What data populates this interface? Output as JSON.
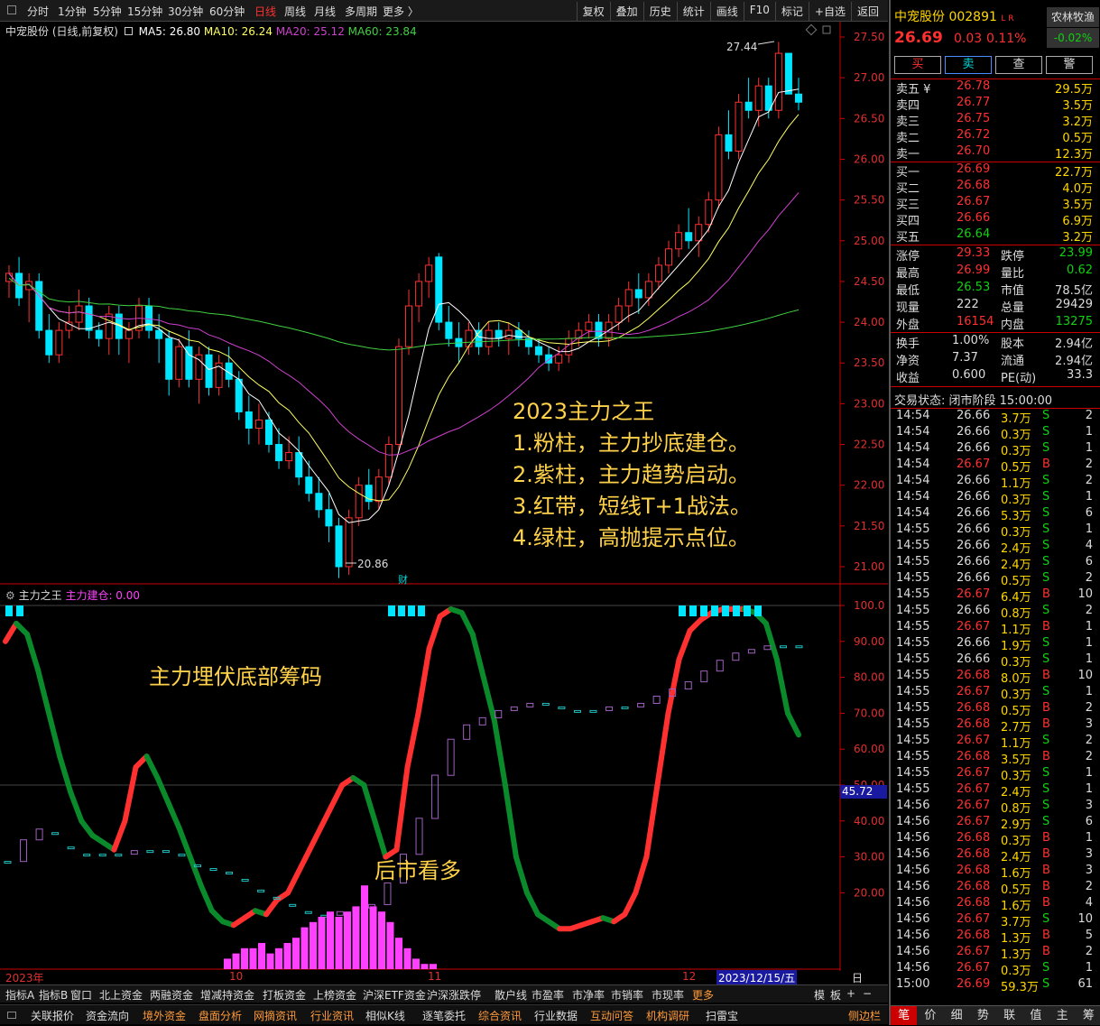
{
  "toolbar": {
    "periods": [
      "分时",
      "1分钟",
      "5分钟",
      "15分钟",
      "30分钟",
      "60分钟",
      "日线",
      "周线",
      "月线",
      "多周期",
      "更多 〉"
    ],
    "active": "日线",
    "right": [
      "复权",
      "叠加",
      "历史",
      "统计",
      "画线",
      "F10",
      "标记",
      "+自选",
      "返回"
    ]
  },
  "legend": {
    "title": "中宠股份 (日线,前复权)",
    "ma5": "MA5: 26.80",
    "ma10": "MA10: 26.24",
    "ma20": "MA20: 25.12",
    "ma60": "MA60: 23.84"
  },
  "colors": {
    "up": "#ff3030",
    "down": "#00e5ff",
    "ma5": "#ffffff",
    "ma10": "#ffff60",
    "ma20": "#d040d0",
    "ma60": "#40d040",
    "annot": "#ffd24a",
    "pink": "#ff40ff",
    "purple": "#a060c0"
  },
  "price_axis": [
    "27.50",
    "27.00",
    "26.50",
    "26.00",
    "25.50",
    "25.00",
    "24.50",
    "24.00",
    "23.50",
    "23.00",
    "22.50",
    "22.00",
    "21.50",
    "21.00"
  ],
  "ind_axis": [
    "100.0",
    "90.00",
    "80.00",
    "70.00",
    "60.00",
    "50.00",
    "40.00",
    "30.00",
    "20.00"
  ],
  "markers": {
    "high": "27.44",
    "low": "20.86",
    "fin": "财",
    "cur": "45.72"
  },
  "ind_legend": {
    "name": "主力之王",
    "label": "主力建仓: 0.00"
  },
  "annotations": {
    "title": "2023主力之王",
    "l1": "1.粉柱，主力抄底建仓。",
    "l2": "2.紫柱，主力趋势启动。",
    "l3": "3.红带，短线T+1战法。",
    "l4": "4.绿柱，高抛提示点位。",
    "bottom_chips": "主力埋伏底部筹码",
    "bullish": "后市看多"
  },
  "dates": {
    "y2023": "2023年",
    "m10": "10",
    "m11": "11",
    "m12": "12",
    "cursor": "2023/12/15/五",
    "period": "日线"
  },
  "bottombar1": [
    "指标A",
    "指标B",
    "窗口",
    "北上资金",
    "两融资金",
    "增减持资金",
    "打板资金",
    "上榜资金",
    "沪深ETF资金",
    "沪深涨跌停",
    "散户线",
    "市盈率",
    "市净率",
    "市销率",
    "市现率",
    "更多"
  ],
  "bottombar1_right": [
    "模",
    "板",
    "+",
    "−"
  ],
  "bottombar2": [
    "关联报价",
    "资金流向",
    "境外资金",
    "盘面分析",
    "网摘资讯",
    "行业资讯",
    "相似K线",
    "逐笔委托",
    "综合资讯",
    "行业数据",
    "互动问答",
    "机构调研",
    "扫雷宝"
  ],
  "bottombar2_right": "侧边栏",
  "quote": {
    "name": "中宠股份",
    "code": "002891",
    "tag": "L R",
    "price": "26.69",
    "chg": "0.03",
    "pct": "0.11%",
    "sector": "农林牧渔",
    "sector_pct": "-0.02%",
    "buttons": [
      "买",
      "卖",
      "查",
      "警"
    ],
    "sell": [
      [
        "卖五 ¥",
        "26.78",
        "29.5万"
      ],
      [
        "卖四",
        "26.77",
        "3.5万"
      ],
      [
        "卖三",
        "26.75",
        "3.2万"
      ],
      [
        "卖二",
        "26.72",
        "0.5万"
      ],
      [
        "卖一",
        "26.70",
        "12.3万"
      ]
    ],
    "buy": [
      [
        "买一",
        "26.69",
        "22.7万"
      ],
      [
        "买二",
        "26.68",
        "4.0万"
      ],
      [
        "买三",
        "26.67",
        "3.5万"
      ],
      [
        "买四",
        "26.66",
        "6.9万"
      ],
      [
        "买五",
        "26.64",
        "3.2万"
      ]
    ],
    "stats": [
      [
        "涨停",
        "29.33",
        "跌停",
        "23.99"
      ],
      [
        "最高",
        "26.99",
        "量比",
        "0.62"
      ],
      [
        "最低",
        "26.53",
        "市值",
        "78.5亿"
      ],
      [
        "现量",
        "222",
        "总量",
        "29429"
      ],
      [
        "外盘",
        "16154",
        "内盘",
        "13275"
      ]
    ],
    "stats2": [
      [
        "换手",
        "1.00%",
        "股本",
        "2.94亿"
      ],
      [
        "净资",
        "7.37",
        "流通",
        "2.94亿"
      ],
      [
        "收益",
        "0.600",
        "PE(动)",
        "33.3"
      ]
    ],
    "status": "交易状态: 闭市阶段 15:00:00",
    "ticks": [
      [
        "14:54",
        "26.66",
        "3.7万",
        "S",
        "2"
      ],
      [
        "14:54",
        "26.66",
        "0.3万",
        "S",
        "1"
      ],
      [
        "14:54",
        "26.66",
        "0.3万",
        "S",
        "1"
      ],
      [
        "14:54",
        "26.67",
        "0.5万",
        "B",
        "2"
      ],
      [
        "14:54",
        "26.66",
        "1.1万",
        "S",
        "2"
      ],
      [
        "14:54",
        "26.66",
        "0.3万",
        "S",
        "1"
      ],
      [
        "14:54",
        "26.66",
        "5.3万",
        "S",
        "6"
      ],
      [
        "14:55",
        "26.66",
        "0.3万",
        "S",
        "1"
      ],
      [
        "14:55",
        "26.66",
        "2.4万",
        "S",
        "4"
      ],
      [
        "14:55",
        "26.66",
        "2.4万",
        "S",
        "6"
      ],
      [
        "14:55",
        "26.66",
        "0.5万",
        "S",
        "2"
      ],
      [
        "14:55",
        "26.67",
        "6.4万",
        "B",
        "10"
      ],
      [
        "14:55",
        "26.66",
        "0.8万",
        "S",
        "2"
      ],
      [
        "14:55",
        "26.67",
        "1.1万",
        "B",
        "1"
      ],
      [
        "14:55",
        "26.66",
        "1.9万",
        "S",
        "1"
      ],
      [
        "14:55",
        "26.66",
        "0.3万",
        "S",
        "1"
      ],
      [
        "14:55",
        "26.68",
        "8.0万",
        "B",
        "10"
      ],
      [
        "14:55",
        "26.67",
        "0.3万",
        "S",
        "1"
      ],
      [
        "14:55",
        "26.68",
        "0.5万",
        "B",
        "2"
      ],
      [
        "14:55",
        "26.68",
        "2.7万",
        "B",
        "3"
      ],
      [
        "14:55",
        "26.67",
        "1.1万",
        "S",
        "2"
      ],
      [
        "14:55",
        "26.68",
        "3.5万",
        "B",
        "2"
      ],
      [
        "14:55",
        "26.67",
        "0.3万",
        "S",
        "1"
      ],
      [
        "14:55",
        "26.67",
        "2.4万",
        "S",
        "1"
      ],
      [
        "14:56",
        "26.67",
        "0.8万",
        "S",
        "3"
      ],
      [
        "14:56",
        "26.67",
        "2.9万",
        "S",
        "6"
      ],
      [
        "14:56",
        "26.68",
        "0.3万",
        "B",
        "1"
      ],
      [
        "14:56",
        "26.68",
        "2.4万",
        "B",
        "3"
      ],
      [
        "14:56",
        "26.68",
        "1.6万",
        "B",
        "3"
      ],
      [
        "14:56",
        "26.68",
        "0.5万",
        "B",
        "2"
      ],
      [
        "14:56",
        "26.68",
        "1.6万",
        "B",
        "4"
      ],
      [
        "14:56",
        "26.67",
        "3.7万",
        "S",
        "10"
      ],
      [
        "14:56",
        "26.68",
        "1.3万",
        "B",
        "5"
      ],
      [
        "14:56",
        "26.67",
        "1.3万",
        "B",
        "2"
      ],
      [
        "14:56",
        "26.67",
        "0.3万",
        "S",
        "1"
      ],
      [
        "15:00",
        "26.69",
        "59.3万",
        "S",
        "61"
      ]
    ],
    "tabs": [
      "笔",
      "价",
      "细",
      "势",
      "联",
      "值",
      "主",
      "筹"
    ]
  },
  "chart_data": {
    "type": "candlestick",
    "title": "中宠股份 (日线,前复权)",
    "ylim": [
      20.6,
      27.75
    ],
    "candles": [
      [
        24.5,
        24.7,
        24.3,
        24.6
      ],
      [
        24.6,
        24.8,
        24.2,
        24.3
      ],
      [
        24.4,
        24.6,
        24.0,
        24.5
      ],
      [
        24.5,
        24.6,
        23.8,
        23.9
      ],
      [
        23.9,
        24.1,
        23.5,
        23.6
      ],
      [
        23.6,
        24.0,
        23.5,
        23.9
      ],
      [
        23.9,
        24.2,
        23.8,
        24.0
      ],
      [
        24.0,
        24.4,
        23.9,
        24.2
      ],
      [
        24.2,
        24.3,
        23.8,
        23.9
      ],
      [
        23.9,
        24.0,
        23.7,
        23.8
      ],
      [
        23.8,
        24.2,
        23.6,
        24.1
      ],
      [
        24.1,
        24.2,
        23.6,
        23.8
      ],
      [
        23.8,
        24.0,
        23.5,
        23.9
      ],
      [
        23.9,
        24.3,
        23.8,
        24.2
      ],
      [
        24.2,
        24.3,
        23.8,
        23.9
      ],
      [
        23.9,
        24.1,
        23.5,
        23.8
      ],
      [
        23.8,
        23.9,
        23.1,
        23.3
      ],
      [
        23.3,
        23.8,
        23.2,
        23.7
      ],
      [
        23.7,
        23.9,
        23.2,
        23.3
      ],
      [
        23.3,
        23.7,
        23.0,
        23.6
      ],
      [
        23.6,
        23.7,
        23.1,
        23.2
      ],
      [
        23.2,
        23.6,
        23.1,
        23.5
      ],
      [
        23.5,
        23.7,
        23.2,
        23.3
      ],
      [
        23.3,
        23.4,
        22.8,
        22.9
      ],
      [
        22.9,
        23.1,
        22.5,
        22.7
      ],
      [
        22.7,
        23.0,
        22.5,
        22.8
      ],
      [
        22.8,
        22.9,
        22.4,
        22.5
      ],
      [
        22.5,
        22.7,
        22.2,
        22.3
      ],
      [
        22.3,
        22.6,
        22.2,
        22.4
      ],
      [
        22.4,
        22.6,
        22.0,
        22.1
      ],
      [
        22.1,
        22.3,
        21.8,
        21.9
      ],
      [
        21.9,
        22.1,
        21.6,
        21.7
      ],
      [
        21.7,
        21.9,
        21.3,
        21.5
      ],
      [
        21.5,
        21.6,
        20.86,
        21.0
      ],
      [
        21.0,
        21.7,
        20.9,
        21.6
      ],
      [
        21.6,
        22.1,
        21.5,
        22.0
      ],
      [
        22.0,
        22.2,
        21.7,
        21.8
      ],
      [
        21.8,
        22.2,
        21.7,
        22.1
      ],
      [
        22.1,
        22.6,
        22.0,
        22.5
      ],
      [
        22.5,
        23.8,
        22.4,
        23.7
      ],
      [
        23.7,
        24.4,
        23.6,
        24.2
      ],
      [
        24.2,
        24.6,
        24.0,
        24.5
      ],
      [
        24.5,
        24.8,
        24.3,
        24.7
      ],
      [
        24.8,
        24.85,
        23.9,
        24.0
      ],
      [
        24.0,
        24.2,
        23.7,
        23.8
      ],
      [
        23.8,
        24.0,
        23.5,
        23.7
      ],
      [
        23.7,
        24.0,
        23.6,
        23.9
      ],
      [
        23.9,
        24.0,
        23.6,
        23.7
      ],
      [
        23.7,
        24.0,
        23.6,
        23.9
      ],
      [
        23.9,
        24.0,
        23.7,
        23.8
      ],
      [
        23.8,
        24.0,
        23.6,
        23.9
      ],
      [
        23.9,
        24.0,
        23.7,
        23.8
      ],
      [
        23.8,
        23.9,
        23.6,
        23.7
      ],
      [
        23.7,
        23.8,
        23.5,
        23.6
      ],
      [
        23.6,
        23.7,
        23.4,
        23.5
      ],
      [
        23.5,
        23.7,
        23.4,
        23.6
      ],
      [
        23.6,
        23.9,
        23.5,
        23.8
      ],
      [
        23.8,
        24.0,
        23.7,
        23.9
      ],
      [
        23.9,
        24.1,
        23.8,
        24.0
      ],
      [
        24.0,
        24.1,
        23.7,
        23.8
      ],
      [
        23.8,
        24.1,
        23.7,
        24.0
      ],
      [
        24.0,
        24.3,
        23.9,
        24.2
      ],
      [
        24.2,
        24.5,
        24.0,
        24.4
      ],
      [
        24.4,
        24.6,
        24.1,
        24.3
      ],
      [
        24.3,
        24.6,
        24.2,
        24.5
      ],
      [
        24.5,
        24.8,
        24.4,
        24.7
      ],
      [
        24.7,
        25.0,
        24.6,
        24.9
      ],
      [
        24.9,
        25.2,
        24.8,
        25.1
      ],
      [
        25.1,
        25.4,
        24.9,
        25.0
      ],
      [
        25.0,
        25.3,
        24.8,
        25.2
      ],
      [
        25.2,
        25.6,
        25.1,
        25.5
      ],
      [
        25.5,
        26.4,
        25.4,
        26.3
      ],
      [
        26.3,
        26.6,
        26.0,
        26.1
      ],
      [
        26.1,
        26.8,
        26.0,
        26.7
      ],
      [
        26.7,
        27.0,
        26.5,
        26.6
      ],
      [
        26.6,
        27.0,
        26.4,
        26.9
      ],
      [
        26.9,
        27.0,
        26.5,
        26.6
      ],
      [
        26.6,
        27.44,
        26.5,
        27.3
      ],
      [
        27.3,
        27.2,
        26.8,
        26.8
      ],
      [
        26.8,
        27.0,
        26.6,
        26.7
      ]
    ],
    "ma_series": [
      {
        "name": "MA5",
        "last": 26.8
      },
      {
        "name": "MA10",
        "last": 26.24
      },
      {
        "name": "MA20",
        "last": 25.12
      },
      {
        "name": "MA60",
        "last": 23.84
      }
    ]
  }
}
